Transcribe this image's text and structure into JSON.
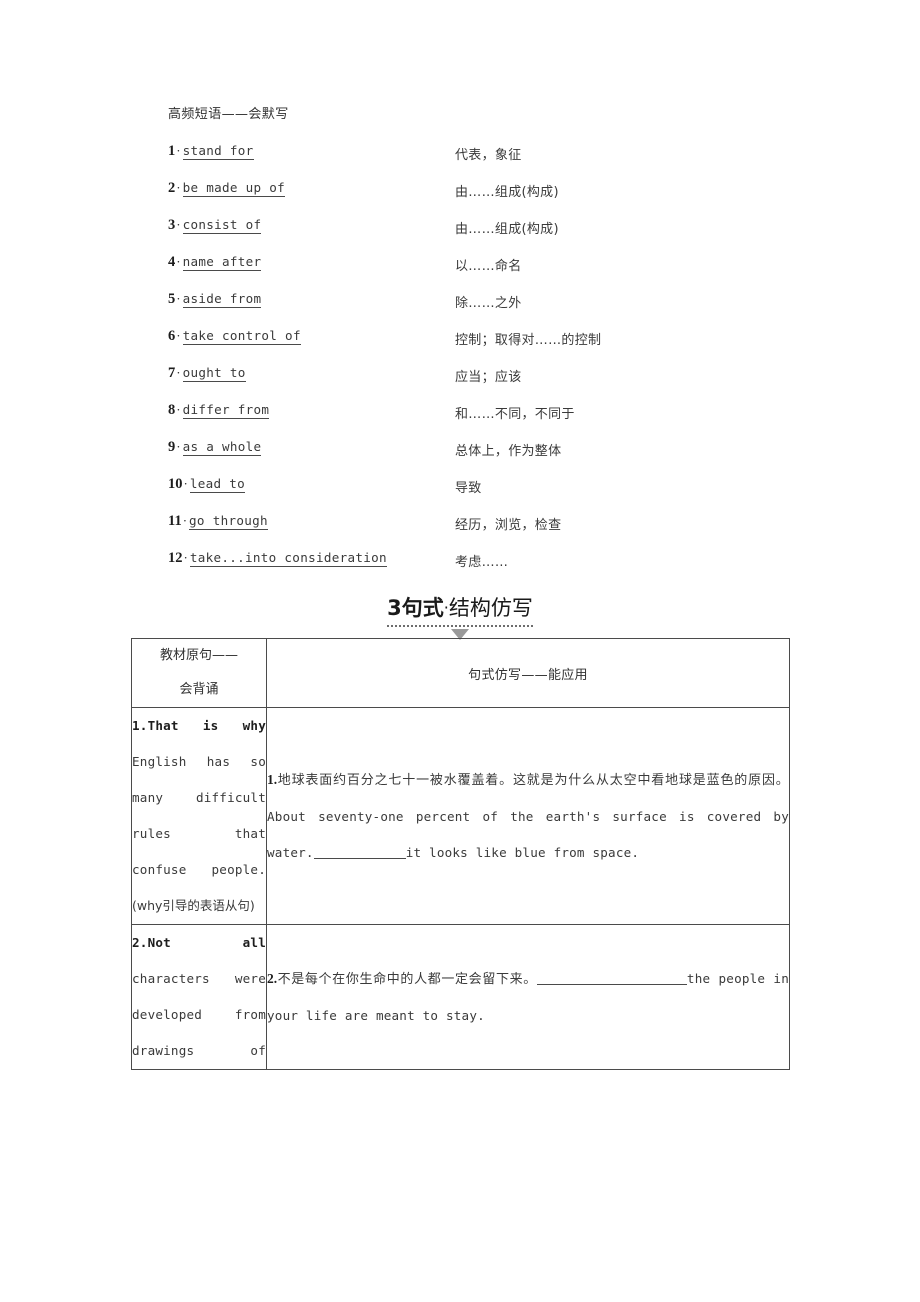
{
  "phrases_section": {
    "heading": "高频短语——会默写",
    "items": [
      {
        "num": "1",
        "sep": "·",
        "en": "stand for",
        "zh": "代表，象征"
      },
      {
        "num": "2",
        "sep": "·",
        "en": "be made up of",
        "zh": "由……组成(构成)"
      },
      {
        "num": "3",
        "sep": "·",
        "en": "consist of",
        "zh": "由……组成(构成)"
      },
      {
        "num": "4",
        "sep": "·",
        "en": "name after",
        "zh": "以……命名"
      },
      {
        "num": "5",
        "sep": "·",
        "en": "aside from",
        "zh": "除……之外"
      },
      {
        "num": "6",
        "sep": "·",
        "en": "take control of",
        "zh": "控制；取得对……的控制"
      },
      {
        "num": "7",
        "sep": "·",
        "en": "ought to",
        "zh": "应当；应该"
      },
      {
        "num": "8",
        "sep": "·",
        "en": "differ from",
        "zh": "和……不同，不同于"
      },
      {
        "num": "9",
        "sep": "·",
        "en": "as a whole",
        "zh": "总体上，作为整体"
      },
      {
        "num": "10",
        "sep": "·",
        "en": "lead to",
        "zh": "导致"
      },
      {
        "num": "11",
        "sep": "·",
        "en": "go through",
        "zh": "经历，浏览，检查"
      },
      {
        "num": "12",
        "sep": "·",
        "en": "take...into consideration",
        "zh": "考虑……"
      }
    ]
  },
  "section_title": {
    "number": "3",
    "bold_part": "句式",
    "separator": "·",
    "rest": "结构仿写"
  },
  "table": {
    "header": {
      "left_line1": "教材原句——",
      "left_line2": "会背诵",
      "right": "句式仿写——能应用"
    },
    "rows": [
      {
        "source": {
          "lead": "1.That is why",
          "rest": "English has so many difficult rules that confuse people.",
          "note": "(why引导的表语从句)"
        },
        "imitation": {
          "num": "1.",
          "zh": "地球表面约百分之七十一被水覆盖着。这就是为什么从太空中看地球是蓝色的原因。",
          "en_before": "About seventy-one percent of the earth's surface is covered by water.",
          "blank": "__________",
          "en_after": "it looks like blue from space."
        }
      },
      {
        "source": {
          "lead": "2.Not all",
          "rest": "characters were developed from drawings of",
          "note": ""
        },
        "imitation": {
          "num": "2.",
          "zh": "不是每个在你生命中的人都一定会留下来。",
          "en_before": "",
          "blank": "________________",
          "en_after": "the people in your life are meant to stay."
        }
      }
    ]
  },
  "colors": {
    "text": "#3a3a3a",
    "border": "#4b4b4b",
    "triangle": "#9a9a9a"
  }
}
